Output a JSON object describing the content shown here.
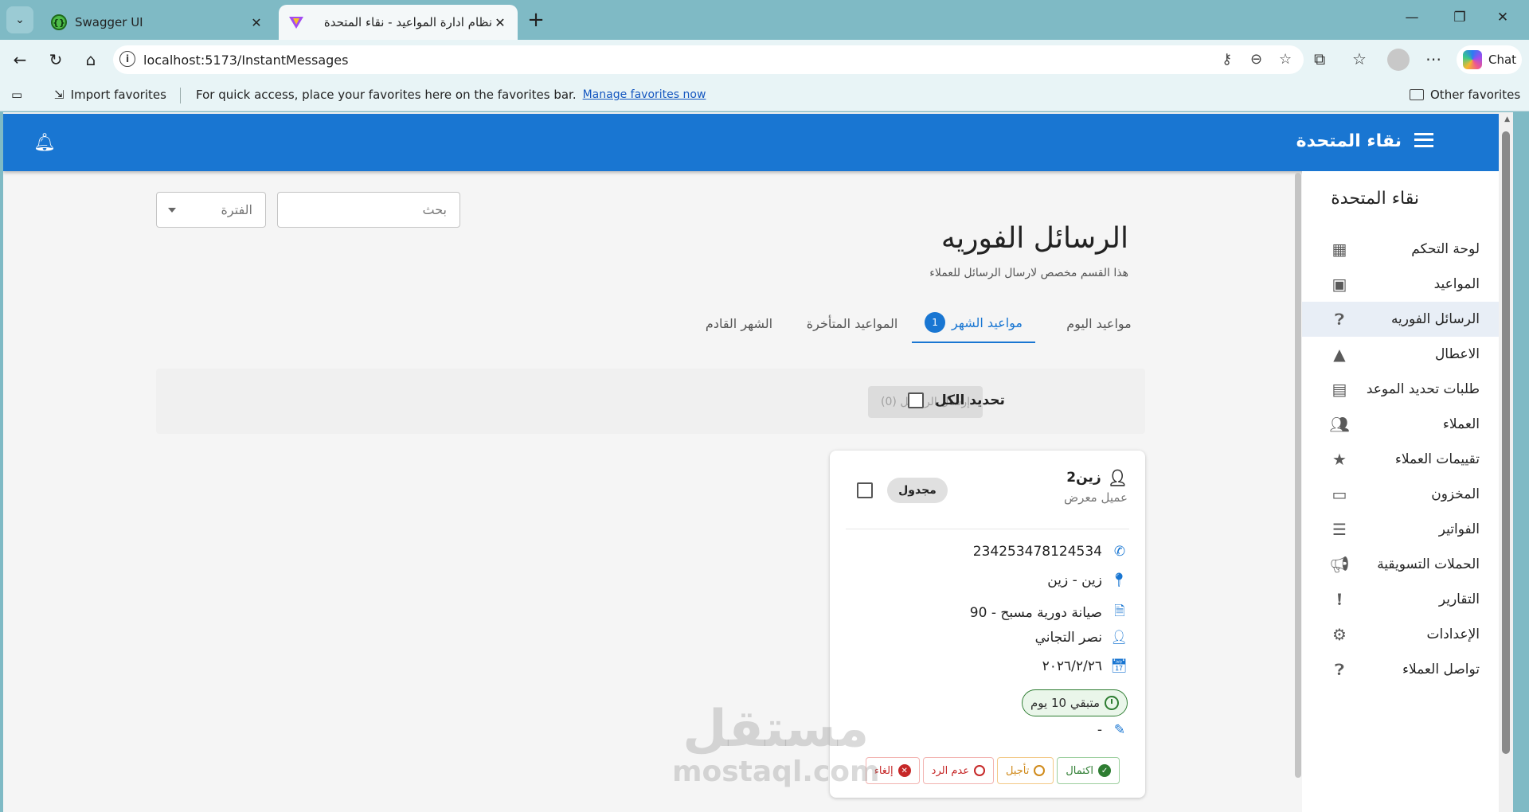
{
  "browser": {
    "tabs": [
      {
        "title": "Swagger UI",
        "favicon": "swagger-icon"
      },
      {
        "title": "نظام ادارة المواعيد - نقاء المتحدة",
        "favicon": "vite-icon"
      }
    ],
    "url": "localhost:5173/InstantMessages",
    "chat_label": "Chat",
    "favorites_bar": {
      "import_label": "Import favorites",
      "message": "For quick access, place your favorites here on the favorites bar.",
      "manage_link": "Manage favorites now",
      "other_label": "Other favorites"
    }
  },
  "header": {
    "brand": "نقاء المتحدة",
    "brand_color": "#1976d2"
  },
  "sidebar": {
    "brand": "نقاء المتحدة",
    "items": [
      {
        "label": "لوحة التحكم",
        "icon": "dashboard-icon"
      },
      {
        "label": "المواعيد",
        "icon": "calendar-icon"
      },
      {
        "label": "الرسائل الفوريه",
        "icon": "help-circle-icon",
        "active": true
      },
      {
        "label": "الاعطال",
        "icon": "warning-icon"
      },
      {
        "label": "طلبات تحديد الموعد",
        "icon": "clipboard-icon"
      },
      {
        "label": "العملاء",
        "icon": "people-icon"
      },
      {
        "label": "تقييمات العملاء",
        "icon": "star-icon"
      },
      {
        "label": "المخزون",
        "icon": "archive-icon"
      },
      {
        "label": "الفواتير",
        "icon": "receipt-icon"
      },
      {
        "label": "الحملات التسويقية",
        "icon": "megaphone-icon"
      },
      {
        "label": "التقارير",
        "icon": "report-icon"
      },
      {
        "label": "الإعدادات",
        "icon": "gear-icon"
      },
      {
        "label": "تواصل العملاء",
        "icon": "help-circle-icon"
      }
    ]
  },
  "page": {
    "title": "الرسائل الفوريه",
    "subtitle": "هذا القسم مخصص لارسال الرسائل للعملاء",
    "search_placeholder": "بحث",
    "period_placeholder": "الفترة"
  },
  "tabs": [
    {
      "label": "مواعيد اليوم"
    },
    {
      "label": "مواعيد الشهر",
      "badge": "1",
      "active": true
    },
    {
      "label": "المواعيد المتأخرة"
    },
    {
      "label": "الشهر القادم"
    }
  ],
  "toolbar": {
    "send_label": "إرسال الرسائل (0)",
    "select_all_label": "تحديد الكل"
  },
  "card": {
    "customer_name": "زين2",
    "customer_type": "عميل معرض",
    "status": "مجدول",
    "phone": "234253478124534",
    "location": "زين - زين",
    "service": "صيانة دورية مسبح - 90",
    "technician": "نصر التجاني",
    "date": "٢٠٢٦/٢/٢٦",
    "remaining": "متبقي 10 يوم",
    "note": "-",
    "actions": {
      "complete": "اكتمال",
      "postpone": "تأجيل",
      "no_reply": "عدم الرد",
      "cancel": "إلغاء"
    }
  },
  "watermark": {
    "arabic": "مستقل",
    "latin": "mostaql.com"
  }
}
